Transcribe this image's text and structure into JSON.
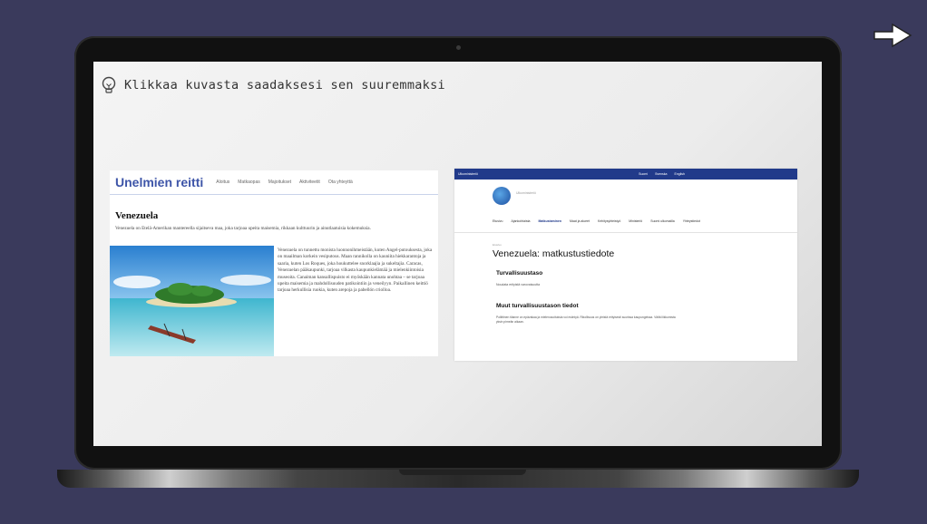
{
  "hint": {
    "text": "Klikkaa kuvasta saadaksesi sen suuremmaksi",
    "icon": "lightbulb-icon"
  },
  "next": {
    "icon": "arrow-right-icon"
  },
  "left_page": {
    "logo": "Unelmien reitti",
    "nav": [
      "Aloitus",
      "Matkaopas",
      "Majoitukset",
      "Aktiviteetit",
      "Ota yhteyttä"
    ],
    "title": "Venezuela",
    "intro": "Venezuela on Etelä-Amerikan mantereella sijaitseva maa, joka tarjoaa upeita maisemia, rikkaan kulttuurin ja ainutlaatuisia kokemuksia.",
    "body": "Venezuela on tunnettu monista luonnonihmeistään, kuten Angel-putouksesta, joka on maailman korkein vesiputous. Maan rannikolla on kauniita hiekkarantoja ja saaria, kuten Los Roques, joka houkuttelee snorklaajia ja sukeltajia. Caracas, Venezuelan pääkaupunki, tarjoaa vilkasta kaupunkielämää ja mielenkiintoisia museoita. Canaiman kansallispuisto ei myöskään kannata unohtaa – se tarjoaa upeita maisemia ja mahdollisuuden patikointiin ja veneilyyn. Paikallinen keittiö tarjoaa herkullisia ruokia, kuten arepoja ja pabellón criolloa."
  },
  "right_page": {
    "ministry": "Ulkoministeriö",
    "langs": [
      "Suomi",
      "Svenska",
      "English"
    ],
    "logo_text": "Ulkoministeriö",
    "nav": [
      "Etusivu",
      "Ajankohtaista",
      "Matkustaminen",
      "Maat ja alueet",
      "Kehitysyhteistyö",
      "Ministeriö",
      "Suomi ulkomailla",
      "Yhteystiedot"
    ],
    "active_nav": "Matkustaminen",
    "crumb": "Etusivu",
    "title": "Venezuela: matkustustiedote",
    "h2a": "Turvallisuustaso",
    "p1": "Noudata erityistä varovaisuutta",
    "h2b": "Muut turvallisuustason tiedot",
    "p2": "Poliittinen tilanne on epävakaa ja mielenosoituksia voi esiintyä. Rikollisuus on yleistä erityisesti suurissa kaupungeissa. Vältä liikkumista yksin pimeän aikaan."
  }
}
